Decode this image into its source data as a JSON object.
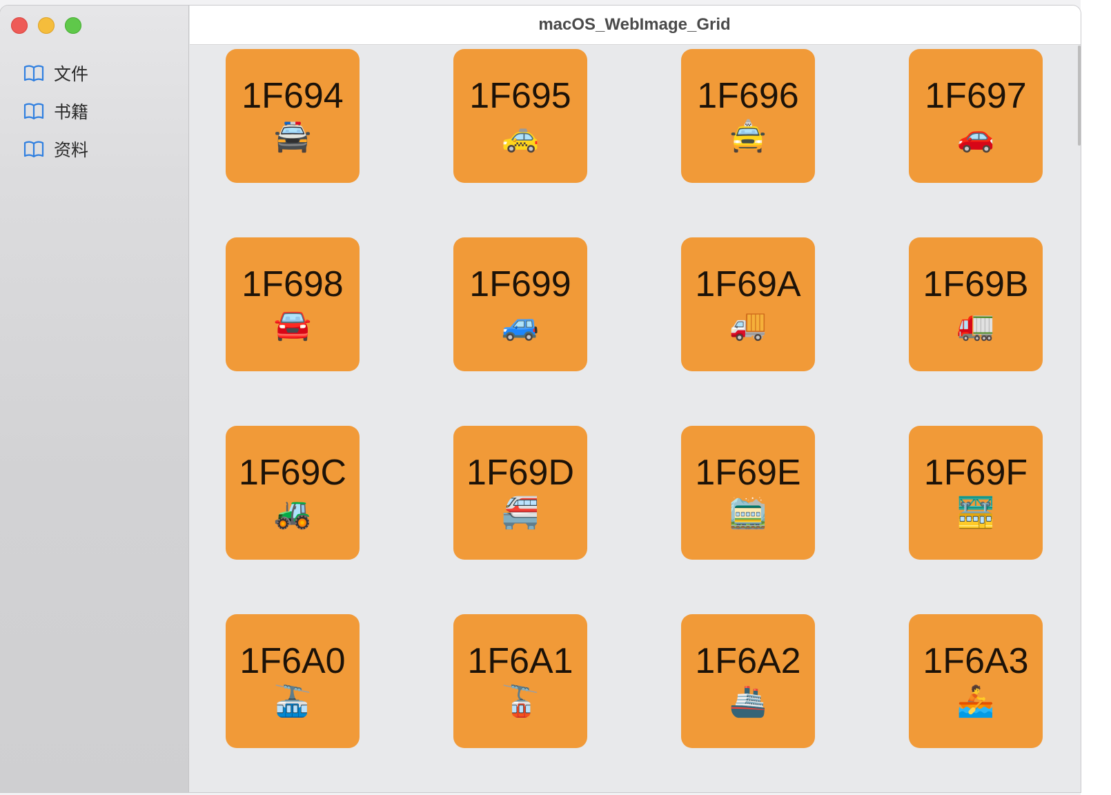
{
  "window": {
    "title": "macOS_WebImage_Grid"
  },
  "sidebar": {
    "items": [
      {
        "label": "文件",
        "icon": "book-icon"
      },
      {
        "label": "书籍",
        "icon": "book-icon"
      },
      {
        "label": "资料",
        "icon": "book-icon"
      }
    ]
  },
  "colors": {
    "tile": "#f19a38",
    "accent": "#2f7fe0"
  },
  "tiles": [
    {
      "code": "1F694",
      "emoji": "🚔"
    },
    {
      "code": "1F695",
      "emoji": "🚕"
    },
    {
      "code": "1F696",
      "emoji": "🚖"
    },
    {
      "code": "1F697",
      "emoji": "🚗"
    },
    {
      "code": "1F698",
      "emoji": "🚘"
    },
    {
      "code": "1F699",
      "emoji": "🚙"
    },
    {
      "code": "1F69A",
      "emoji": "🚚"
    },
    {
      "code": "1F69B",
      "emoji": "🚛"
    },
    {
      "code": "1F69C",
      "emoji": "🚜"
    },
    {
      "code": "1F69D",
      "emoji": "🚝"
    },
    {
      "code": "1F69E",
      "emoji": "🚞"
    },
    {
      "code": "1F69F",
      "emoji": "🚟"
    },
    {
      "code": "1F6A0",
      "emoji": "🚠"
    },
    {
      "code": "1F6A1",
      "emoji": "🚡"
    },
    {
      "code": "1F6A2",
      "emoji": "🚢"
    },
    {
      "code": "1F6A3",
      "emoji": "🚣"
    }
  ]
}
